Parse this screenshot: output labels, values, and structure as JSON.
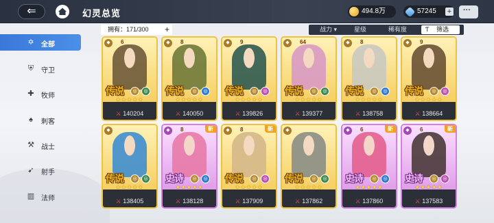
{
  "header": {
    "title": "幻灵总览",
    "back_icon": "back-arrow-icon",
    "home_icon": "home-icon",
    "gold": "494.8万",
    "gems": "57245",
    "plus": "+",
    "chat_icon": "chat-bubble-icon"
  },
  "sidebar": {
    "items": [
      {
        "label": "全部",
        "icon": "star-outline-icon",
        "active": true
      },
      {
        "label": "守卫",
        "icon": "shield-icon",
        "active": false
      },
      {
        "label": "牧师",
        "icon": "cross-icon",
        "active": false
      },
      {
        "label": "刺客",
        "icon": "dagger-icon",
        "active": false
      },
      {
        "label": "战士",
        "icon": "axe-icon",
        "active": false
      },
      {
        "label": "射手",
        "icon": "bow-icon",
        "active": false
      },
      {
        "label": "法师",
        "icon": "book-icon",
        "active": false
      }
    ]
  },
  "filter": {
    "owned": "拥有：171/300",
    "owned_plus": "+",
    "sort_power": "战力 ▾",
    "sort_star": "星级",
    "sort_rarity": "稀有度",
    "filter_btn": "筛选",
    "filter_icon": "funnel-icon"
  },
  "cards": [
    {
      "rarity": "传说",
      "tier": "leg",
      "power": "140204",
      "new": false,
      "lvl": "6",
      "stars": "★★★★★",
      "fig": "#6d5a3a"
    },
    {
      "rarity": "传说",
      "tier": "leg",
      "power": "140050",
      "new": false,
      "lvl": "8",
      "stars": "★★★★★",
      "fig": "#6f7a3a"
    },
    {
      "rarity": "传说",
      "tier": "leg",
      "power": "139826",
      "new": false,
      "lvl": "9",
      "stars": "★★★★★",
      "fig": "#2f5a52"
    },
    {
      "rarity": "传说",
      "tier": "leg",
      "power": "139377",
      "new": false,
      "lvl": "64",
      "stars": "★★★★★",
      "fig": "#d99ac4"
    },
    {
      "rarity": "传说",
      "tier": "leg",
      "power": "138758",
      "new": false,
      "lvl": "8",
      "stars": "★★★★★",
      "fig": "#c9c9c0"
    },
    {
      "rarity": "传说",
      "tier": "leg",
      "power": "138664",
      "new": false,
      "lvl": "9",
      "stars": "★★★★★",
      "fig": "#6a5236"
    },
    {
      "rarity": "传说",
      "tier": "leg",
      "power": "138405",
      "new": false,
      "lvl": "",
      "stars": "★★★★★",
      "fig": "#3f8ed1"
    },
    {
      "rarity": "史诗",
      "tier": "epic",
      "power": "138128",
      "new": true,
      "lvl": "8",
      "stars": "★★★★★",
      "fig": "#e87aa8"
    },
    {
      "rarity": "传说",
      "tier": "leg",
      "power": "137909",
      "new": true,
      "lvl": "8",
      "stars": "★★★★★",
      "fig": "#d4b88a"
    },
    {
      "rarity": "传说",
      "tier": "leg",
      "power": "137862",
      "new": false,
      "lvl": "",
      "stars": "★★★★★",
      "fig": "#8a8e86"
    },
    {
      "rarity": "史诗",
      "tier": "epic",
      "power": "137860",
      "new": true,
      "lvl": "6",
      "stars": "★★★★★",
      "fig": "#e4608e"
    },
    {
      "rarity": "史诗",
      "tier": "epic",
      "power": "137583",
      "new": true,
      "lvl": "6",
      "stars": "★★★★★",
      "fig": "#4a3a3a"
    }
  ],
  "new_label": "新",
  "power_prefix": "⚔"
}
